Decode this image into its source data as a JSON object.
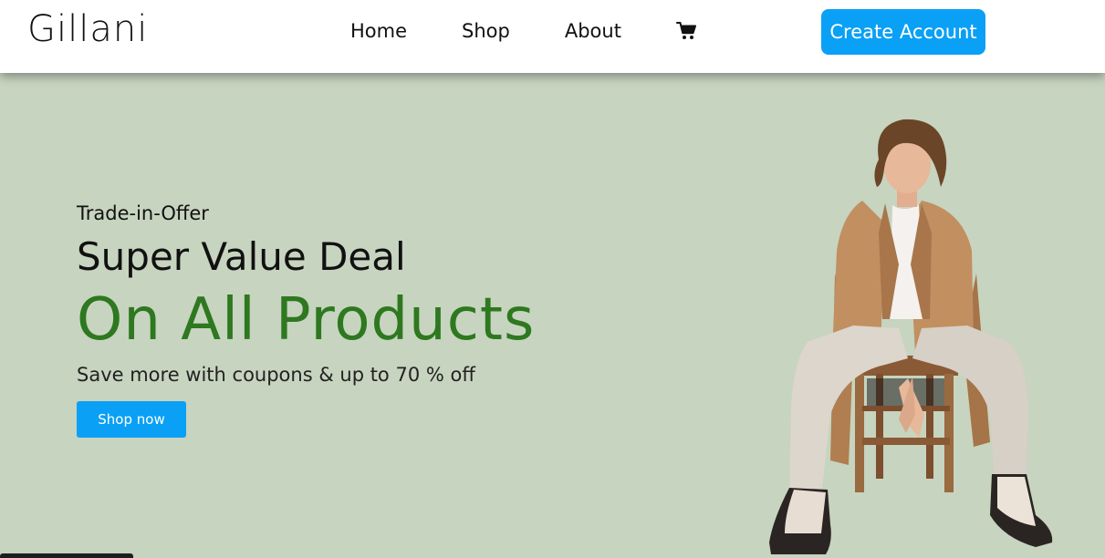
{
  "header": {
    "logo": "Gillani",
    "nav": {
      "home": "Home",
      "shop": "Shop",
      "about": "About",
      "cart_icon": "shopping-cart-icon"
    },
    "create_account_label": "Create Account"
  },
  "hero": {
    "subtitle": "Trade-in-Offer",
    "title": "Super Value Deal",
    "headline": "On All Products",
    "description": "Save more with coupons & up to 70 % off",
    "cta_label": "Shop now"
  },
  "colors": {
    "accent": "#0aa0f5",
    "headline_green": "#2e7820",
    "hero_background": "#c7d4bf",
    "header_background": "#ffffff"
  }
}
